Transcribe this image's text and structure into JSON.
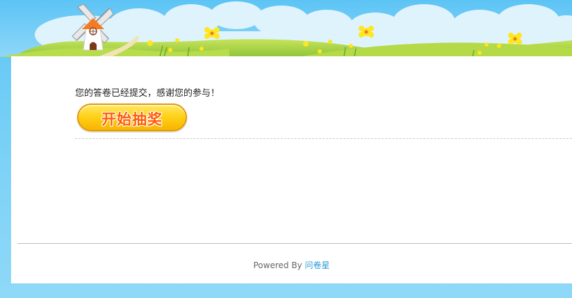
{
  "message": "您的答卷已经提交，感谢您的参与！",
  "lottery_button": {
    "label": "开始抽奖"
  },
  "footer": {
    "powered_by": "Powered By",
    "brand_link": "问卷星"
  },
  "colors": {
    "page_background": "#6ccaf6",
    "sky": "#8ad6f7",
    "grass": "#a9d84a",
    "button_yellow": "#ffd21a",
    "button_text": "#ff5a00",
    "link": "#2a9bd6"
  },
  "icons": [
    "windmill-icon",
    "flower-icon"
  ]
}
